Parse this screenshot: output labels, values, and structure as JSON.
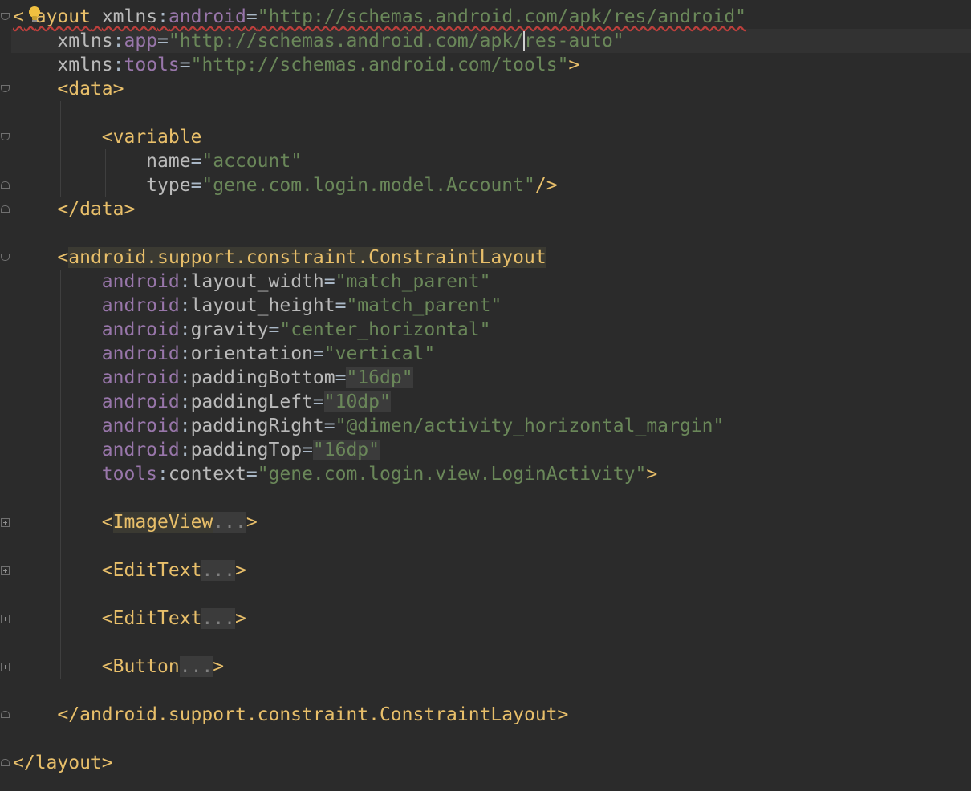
{
  "editor": {
    "language": "XML",
    "theme_colors": {
      "background": "#2b2b2b",
      "tag": "#e8bf6a",
      "namespace": "#9876aa",
      "attribute": "#bababa",
      "string": "#6a8759"
    },
    "lines": {
      "l1": {
        "open": "<",
        "tag_rest": "ayout",
        "sp1": " ",
        "attr1": "xmlns",
        "colon1": ":",
        "ns1": "android",
        "eq1": "=",
        "val1": "\"http://schemas.android.com/apk/res/android\""
      },
      "l2": {
        "indent": "    ",
        "attr": "xmlns",
        "colon": ":",
        "ns": "app",
        "eq": "=",
        "val_a": "\"http://schemas.android.com/apk/",
        "val_b": "res-auto\""
      },
      "l3": {
        "indent": "    ",
        "attr": "xmlns",
        "colon": ":",
        "ns": "tools",
        "eq": "=",
        "val": "\"http://schemas.android.com/tools\"",
        "close": ">"
      },
      "l4": {
        "indent": "    ",
        "text": "<data>"
      },
      "l6": {
        "indent": "        ",
        "text": "<variable"
      },
      "l7": {
        "indent": "            ",
        "attr": "name",
        "eq": "=",
        "val": "\"account\""
      },
      "l8": {
        "indent": "            ",
        "attr": "type",
        "eq": "=",
        "val": "\"gene.com.login.model.Account\"",
        "close": "/>"
      },
      "l9": {
        "indent": "    ",
        "text": "</data>"
      },
      "l11": {
        "indent": "    ",
        "open": "<",
        "tag": "android.support.constraint.ConstraintLayout"
      },
      "l12": {
        "ns": "android",
        "colon": ":",
        "attr": "layout_width",
        "eq": "=",
        "val": "\"match_parent\""
      },
      "l13": {
        "ns": "android",
        "colon": ":",
        "attr": "layout_height",
        "eq": "=",
        "val": "\"match_parent\""
      },
      "l14": {
        "ns": "android",
        "colon": ":",
        "attr": "gravity",
        "eq": "=",
        "val": "\"center_horizontal\""
      },
      "l15": {
        "ns": "android",
        "colon": ":",
        "attr": "orientation",
        "eq": "=",
        "val": "\"vertical\""
      },
      "l16": {
        "ns": "android",
        "colon": ":",
        "attr": "paddingBottom",
        "eq": "=",
        "val": "\"16dp\""
      },
      "l17": {
        "ns": "android",
        "colon": ":",
        "attr": "paddingLeft",
        "eq": "=",
        "val": "\"10dp\""
      },
      "l18": {
        "ns": "android",
        "colon": ":",
        "attr": "paddingRight",
        "eq": "=",
        "val": "\"@dimen/activity_horizontal_margin\""
      },
      "l19": {
        "ns": "android",
        "colon": ":",
        "attr": "paddingTop",
        "eq": "=",
        "val": "\"16dp\""
      },
      "l20": {
        "ns": "tools",
        "colon": ":",
        "attr": "context",
        "eq": "=",
        "val": "\"gene.com.login.view.LoginActivity\"",
        "close": ">"
      },
      "l22": {
        "open": "<",
        "tag": "ImageView",
        "dots": "...",
        "close": ">"
      },
      "l24": {
        "open": "<",
        "tag": "EditText",
        "dots": "...",
        "close": ">"
      },
      "l26": {
        "open": "<",
        "tag": "EditText",
        "dots": "...",
        "close": ">"
      },
      "l28": {
        "open": "<",
        "tag": "Button",
        "dots": "...",
        "close": ">"
      },
      "l30": {
        "indent": "    ",
        "text": "</android.support.constraint.ConstraintLayout>"
      },
      "l32": {
        "text": "</layout>"
      }
    },
    "indent8": "        "
  }
}
